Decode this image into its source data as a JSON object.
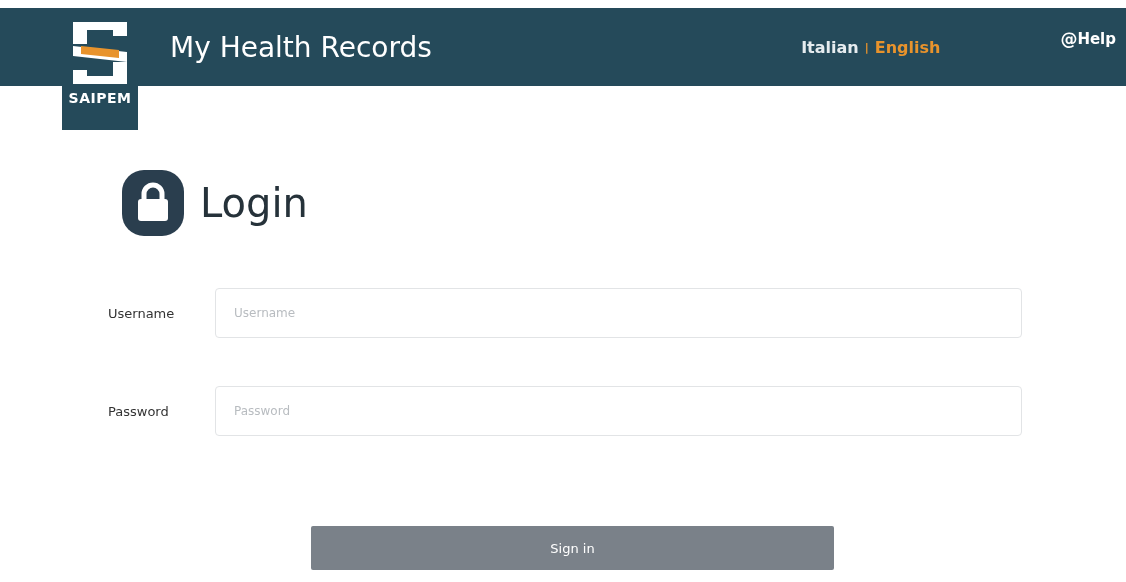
{
  "header": {
    "logo_text": "SAIPEM",
    "title": "My Health Records",
    "languages": [
      {
        "label": "Italian",
        "selected": false
      },
      {
        "label": "English",
        "selected": true
      }
    ],
    "separator": "|",
    "help": {
      "icon": "@",
      "label": "Help"
    }
  },
  "login": {
    "title": "Login",
    "fields": [
      {
        "label": "Username",
        "placeholder": "Username"
      },
      {
        "label": "Password",
        "placeholder": "Password"
      }
    ],
    "button": "Sign in"
  }
}
